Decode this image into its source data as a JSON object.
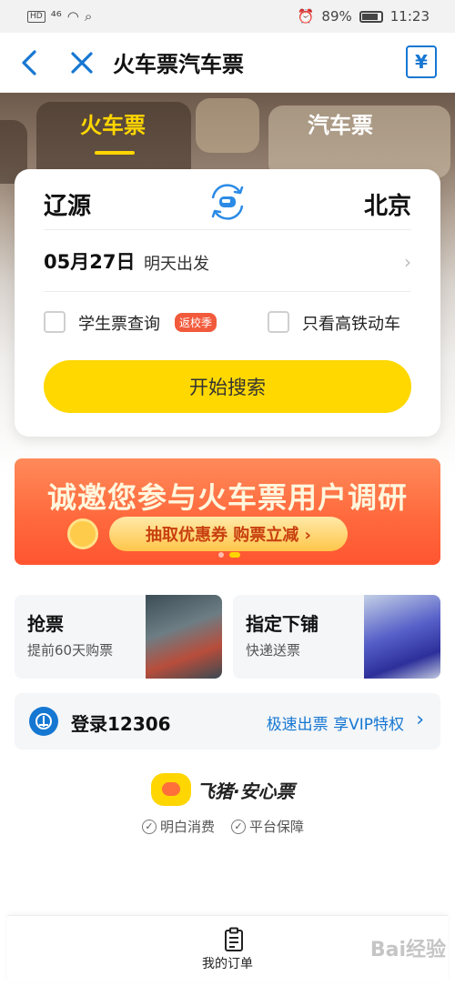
{
  "status_bar": {
    "hd": "HD",
    "signal": "⁴⁶",
    "battery_pct": "89%",
    "time": "11:23"
  },
  "nav": {
    "title": "火车票汽车票",
    "bill_symbol": "¥"
  },
  "tabs": {
    "train": "火车票",
    "bus": "汽车票"
  },
  "search": {
    "from_city": "辽源",
    "to_city": "北京",
    "date": "05月27日",
    "date_note": "明天出发",
    "student_label": "学生票查询",
    "student_badge": "返校季",
    "gaotie_label": "只看高铁动车",
    "search_button": "开始搜索"
  },
  "banner": {
    "title": "诚邀您参与火车票用户调研",
    "pill": "抽取优惠券 购票立减 ›"
  },
  "tiles": [
    {
      "title": "抢票",
      "subtitle": "提前60天购票"
    },
    {
      "title": "指定下铺",
      "subtitle": "快递送票"
    }
  ],
  "login": {
    "label": "登录12306",
    "promo": "极速出票 享VIP特权"
  },
  "brand": {
    "name": "飞猪·安心票",
    "guarantees": [
      "明白消费",
      "平台保障"
    ]
  },
  "bottom": {
    "orders_label": "我的订单"
  },
  "watermark": "Bai经验",
  "colors": {
    "accent_yellow": "#ffd800",
    "brand_blue": "#1677d2",
    "badge_red": "#f25a3c"
  }
}
